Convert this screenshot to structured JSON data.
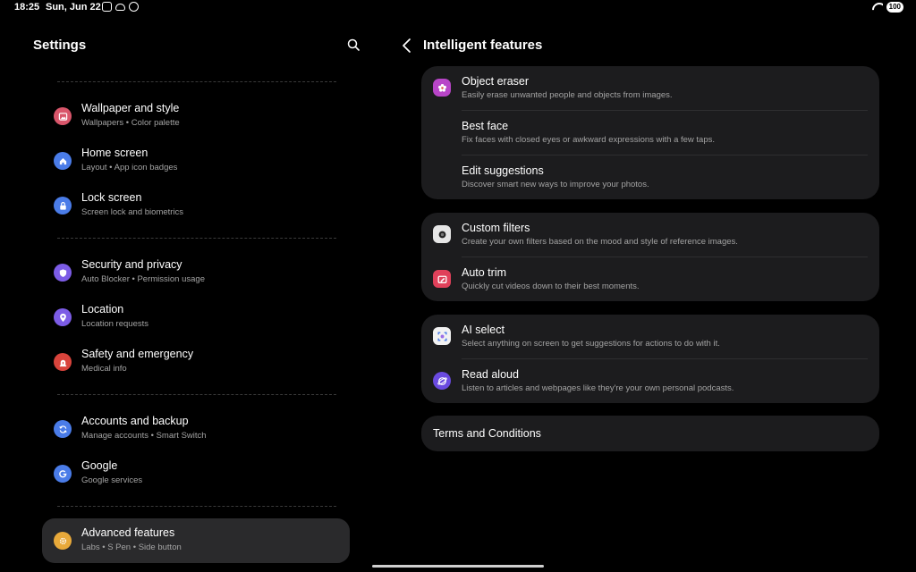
{
  "status": {
    "time": "18:25",
    "date": "Sun, Jun 22",
    "battery": "100"
  },
  "left": {
    "title": "Settings",
    "items": [
      {
        "title": "Wallpaper and style",
        "sub": "Wallpapers  •  Color palette",
        "color": "#d9566b",
        "icon": "image-icon"
      },
      {
        "title": "Home screen",
        "sub": "Layout  •  App icon badges",
        "color": "#4a7ce8",
        "icon": "home-icon"
      },
      {
        "title": "Lock screen",
        "sub": "Screen lock and biometrics",
        "color": "#4a7ce8",
        "icon": "lock-icon"
      },
      {
        "title": "Security and privacy",
        "sub": "Auto Blocker  •  Permission usage",
        "color": "#7c5ce6",
        "icon": "shield-icon"
      },
      {
        "title": "Location",
        "sub": "Location requests",
        "color": "#7c5ce6",
        "icon": "location-pin-icon"
      },
      {
        "title": "Safety and emergency",
        "sub": "Medical info",
        "color": "#d9443c",
        "icon": "emergency-icon"
      },
      {
        "title": "Accounts and backup",
        "sub": "Manage accounts  •  Smart Switch",
        "color": "#4a7ce8",
        "icon": "sync-icon"
      },
      {
        "title": "Google",
        "sub": "Google services",
        "color": "#4a7ce8",
        "icon": "google-icon"
      },
      {
        "title": "Advanced features",
        "sub": "Labs  •  S Pen  •  Side button",
        "color": "#e8a93a",
        "icon": "gear-icon"
      }
    ]
  },
  "right": {
    "title": "Intelligent features",
    "cards": [
      {
        "rows": [
          {
            "title": "Object eraser",
            "sub": "Easily erase unwanted people and objects from images.",
            "icon": "gallery-flower-icon"
          },
          {
            "title": "Best face",
            "sub": "Fix faces with closed eyes or awkward expressions with a few taps.",
            "icon": ""
          },
          {
            "title": "Edit suggestions",
            "sub": "Discover smart new ways to improve your photos.",
            "icon": ""
          }
        ]
      },
      {
        "rows": [
          {
            "title": "Custom filters",
            "sub": "Create your own filters based on the mood and style of reference images.",
            "icon": "camera-icon"
          },
          {
            "title": "Auto trim",
            "sub": "Quickly cut videos down to their best moments.",
            "icon": "video-editor-icon"
          }
        ]
      },
      {
        "rows": [
          {
            "title": "AI select",
            "sub": "Select anything on screen to get suggestions for actions to do with it.",
            "icon": "ai-select-icon"
          },
          {
            "title": "Read aloud",
            "sub": "Listen to articles and webpages like they're your own personal podcasts.",
            "icon": "internet-browser-icon"
          }
        ]
      }
    ],
    "terms": "Terms and Conditions"
  }
}
